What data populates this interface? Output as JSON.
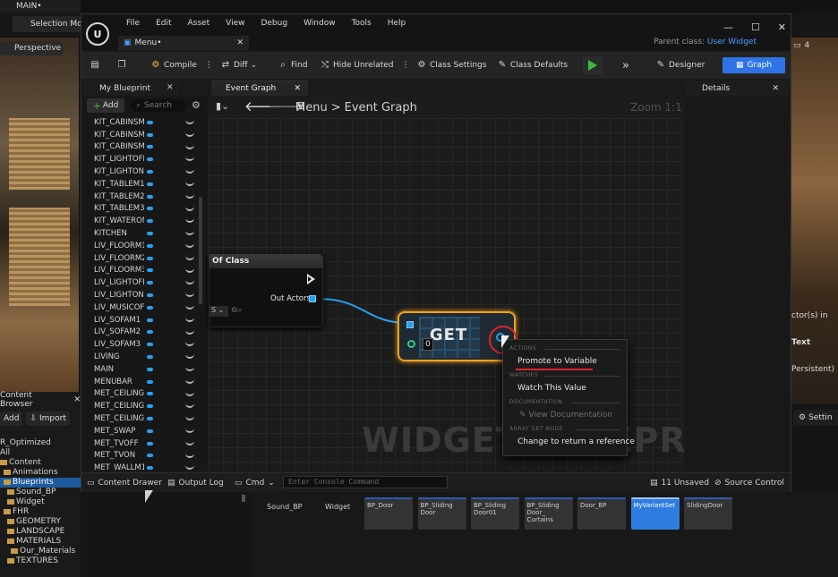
{
  "background_editor": {
    "main_tab": "MAIN•",
    "selection_mode": "Selection Mo",
    "viewport_mode": "Perspective",
    "right_viewport_badge": "4",
    "right_viewport_texts": [
      "ctor(s) in",
      "Text",
      "Persistent)"
    ],
    "settings": "Settin"
  },
  "content_browser": {
    "tab": "Content Browser",
    "add": "Add",
    "import": "Import",
    "tree": [
      {
        "label": "R_Optimized",
        "folder": false,
        "sel": false
      },
      {
        "label": "All",
        "folder": false,
        "sel": false
      },
      {
        "label": "Content",
        "folder": true,
        "sel": false
      },
      {
        "label": "Animations",
        "folder": true,
        "sel": false
      },
      {
        "label": "Blueprints",
        "folder": true,
        "sel": true
      },
      {
        "label": "Sound_BP",
        "folder": true,
        "sel": false
      },
      {
        "label": "Widget",
        "folder": true,
        "sel": false
      },
      {
        "label": "FHR",
        "folder": true,
        "sel": false
      },
      {
        "label": "GEOMETRY",
        "folder": true,
        "sel": false
      },
      {
        "label": "LANDSCAPE",
        "folder": true,
        "sel": false
      },
      {
        "label": "MATERIALS",
        "folder": true,
        "sel": false
      },
      {
        "label": "Our_Materials",
        "folder": true,
        "sel": false
      },
      {
        "label": "TEXTURES",
        "folder": true,
        "sel": false
      }
    ],
    "asset_labels": [
      "Sound_BP",
      "Widget"
    ],
    "asset_tiles": [
      {
        "label": "BP_Door",
        "sel": false
      },
      {
        "label": "BP_Sliding Door",
        "sel": false
      },
      {
        "label": "BP_Sliding Door01",
        "sel": false
      },
      {
        "label": "BP_Sliding Door_ Curtains",
        "sel": false
      },
      {
        "label": "Door_BP",
        "sel": false
      },
      {
        "label": "MyVariantSet",
        "sel": true
      },
      {
        "label": "SlidingDoor",
        "sel": false
      }
    ]
  },
  "window": {
    "menu": [
      "File",
      "Edit",
      "Asset",
      "View",
      "Debug",
      "Window",
      "Tools",
      "Help"
    ],
    "doc_tab": "Menu•",
    "parent_class_label": "Parent class:",
    "parent_class_value": "User Widget",
    "controls": [
      "—",
      "☐",
      "✕"
    ]
  },
  "toolbar": {
    "compile": "Compile",
    "diff": "Diff",
    "find": "Find",
    "hide_unrelated": "Hide Unrelated",
    "class_settings": "Class Settings",
    "class_defaults": "Class Defaults",
    "designer": "Designer",
    "graph": "Graph"
  },
  "my_blueprint": {
    "tab": "My Blueprint",
    "add": "Add",
    "search_placeholder": "Search",
    "variables": [
      "KIT_CABINSM",
      "KIT_CABINSM",
      "KIT_CABINSM",
      "KIT_LIGHTOFF",
      "KIT_LIGHTON",
      "KIT_TABLEM1",
      "KIT_TABLEM2",
      "KIT_TABLEM3",
      "KIT_WATERON",
      "KITCHEN",
      "LIV_FLOORM1",
      "LIV_FLOORM2",
      "LIV_FLOORM3",
      "LIV_LIGHTOFI",
      "LIV_LIGHTON",
      "LIV_MUSICOF",
      "LIV_SOFAM1",
      "LIV_SOFAM2",
      "LIV_SOFAM3",
      "LIVING",
      "MAIN",
      "MENUBAR",
      "MET_CEILING",
      "MET_CEILING",
      "MET_CEILING",
      "MET_SWAP",
      "MET_TVOFF",
      "MET_TVON",
      "MET_WALLM1"
    ]
  },
  "event_graph": {
    "tab": "Event Graph",
    "breadcrumb_root": "Menu",
    "breadcrumb_sep": ">",
    "breadcrumb_current": "Event Graph",
    "zoom": "Zoom 1:1",
    "watermark": "WIDGET BLUEPRINT",
    "getall_node_title": "Of Class",
    "getall_class_value": "S",
    "out_actors": "Out Actors",
    "get_node_label": "GET",
    "get_index": "0"
  },
  "context_menu": {
    "sections": [
      {
        "header": "ACTIONS",
        "items": [
          {
            "label": "Promote to Variable",
            "disabled": false
          }
        ]
      },
      {
        "header": "WATCHES",
        "items": [
          {
            "label": "Watch This Value",
            "disabled": false
          }
        ]
      },
      {
        "header": "DOCUMENTATION",
        "items": [
          {
            "label": "View Documentation",
            "disabled": true
          }
        ]
      },
      {
        "header": "ARRAY GET NODE",
        "items": [
          {
            "label": "Change to return a reference",
            "disabled": false
          }
        ]
      }
    ]
  },
  "details": {
    "tab": "Details"
  },
  "bottom_bar": {
    "content_drawer": "Content Drawer",
    "output_log": "Output Log",
    "cmd": "Cmd",
    "console_placeholder": "Enter Console Command",
    "unsaved": "11 Unsaved",
    "source_control": "Source Control"
  },
  "colors": {
    "accent": "#2f74e6",
    "exec_green": "#3dbb3d",
    "array_pin": "#28a0f0",
    "selection_orange": "#f0a020",
    "highlight_red": "#e0242e"
  }
}
